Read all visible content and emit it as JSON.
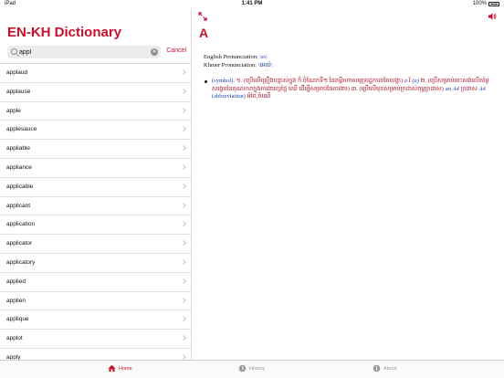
{
  "statusbar": {
    "carrier": "iPad",
    "time": "1:41 PM",
    "battery": "100%"
  },
  "app": {
    "title": "EN-KH Dictionary"
  },
  "search": {
    "value": "appl",
    "clear_icon": "clear-icon",
    "cancel_label": "Cancel"
  },
  "word_list": [
    "applaud",
    "applause",
    "apple",
    "applesauce",
    "appliable",
    "appliance",
    "applicable",
    "applicant",
    "application",
    "applicator",
    "applicatory",
    "applied",
    "applien",
    "applique",
    "applot",
    "apply"
  ],
  "entry": {
    "headword": "A",
    "english_pron_label": "English Pronunciation:",
    "english_pron_value": "\\eɪ\\",
    "khmer_pron_label": "Khmer Pronunciation:",
    "khmer_pron_value": "\\អេយ៉\\",
    "definition": {
      "pos": "(symbol).",
      "text_1": " ១. (ប្រើលើគ្រឿងបន្លាស់ក្នុង ក៏ ចំណែកទី១ នៃគម្ពីរហាសមុទ្ររដ្ឋកាលតែលង្វា) ",
      "ex_1": "a",
      "text_2": " វ៉ ",
      "ex_2": "(a)",
      "text_3": " ២. (ប្រើសម្រាប់ចេះសង់លើតម្លៃសង្ខេបនៃគុណភាពក្នុងការងារល្អផ្ទៃ ឈើ ដើម្បីសម្រាប់ផែការងារ) ៣. (ប្រើលើមុខសម្រាប់ក្រដាស់ពុម្ពក្រដាស) ",
      "ex_3": "an A4",
      "text_4": " ក្រដាស ",
      "ex_4": "A4",
      "abbr": " (abbreviation)",
      "text_5": " អំពែ,ចំណើ"
    }
  },
  "tabs": [
    {
      "label": "Home",
      "active": true
    },
    {
      "label": "History",
      "active": false
    },
    {
      "label": "About",
      "active": false
    }
  ],
  "colors": {
    "accent": "#c8102e",
    "link_blue": "#1a3fb0",
    "inactive": "#9a9a9e"
  }
}
